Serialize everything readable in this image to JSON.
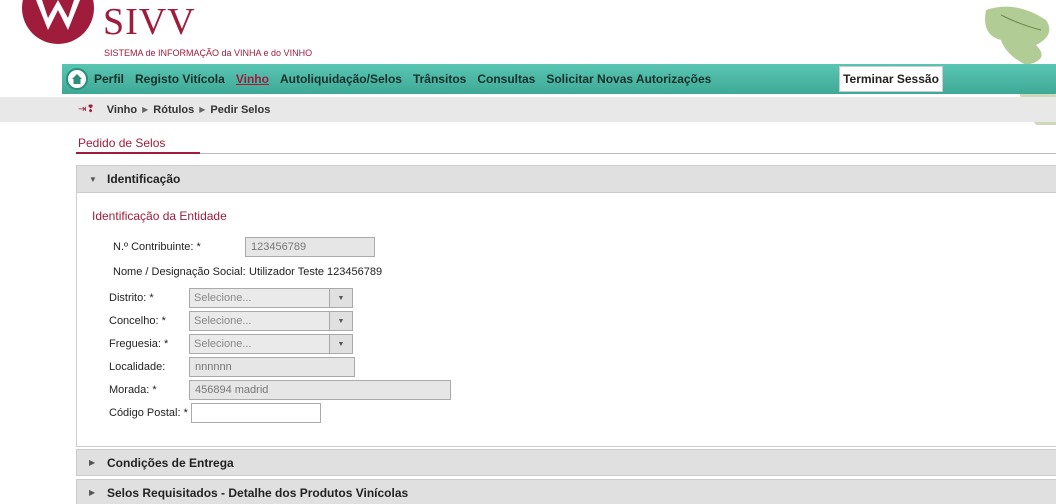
{
  "header": {
    "logo_text": "SIVV",
    "logo_subtitle": "SISTEMA de INFORMAÇÃO da VINHA e do VINHO"
  },
  "nav": {
    "items": [
      {
        "label": "Perfil"
      },
      {
        "label": "Registo Vitícola"
      },
      {
        "label": "Vinho",
        "active": true
      },
      {
        "label": "Autoliquidação/Selos"
      },
      {
        "label": "Trânsitos"
      },
      {
        "label": "Consultas"
      },
      {
        "label": "Solicitar Novas Autorizações"
      }
    ],
    "logout_label": "Terminar Sessão"
  },
  "breadcrumb": [
    "Vinho",
    "Rótulos",
    "Pedir Selos"
  ],
  "tab": {
    "label": "Pedido de Selos"
  },
  "panels": {
    "identificacao": {
      "title": "Identificação",
      "section_title": "Identificação da Entidade",
      "nif_label": "N.º Contribuinte: *",
      "nif_value": "123456789",
      "nome_label": "Nome / Designação Social:",
      "nome_value": "Utilizador Teste 123456789",
      "distrito_label": "Distrito: *",
      "distrito_value": "Selecione...",
      "concelho_label": "Concelho: *",
      "concelho_value": "Selecione...",
      "freguesia_label": "Freguesia: *",
      "freguesia_value": "Selecione...",
      "localidade_label": "Localidade:",
      "localidade_value": "nnnnnn",
      "morada_label": "Morada: *",
      "morada_value": "456894 madrid",
      "codigo_postal_label": "Código Postal: *",
      "codigo_postal_value": ""
    },
    "condicoes": {
      "title": "Condições de Entrega"
    },
    "selos": {
      "title": "Selos Requisitados - Detalhe dos Produtos Vinícolas"
    }
  },
  "colors": {
    "brand": "#a01c3c",
    "nav": "#4bb9a8"
  }
}
